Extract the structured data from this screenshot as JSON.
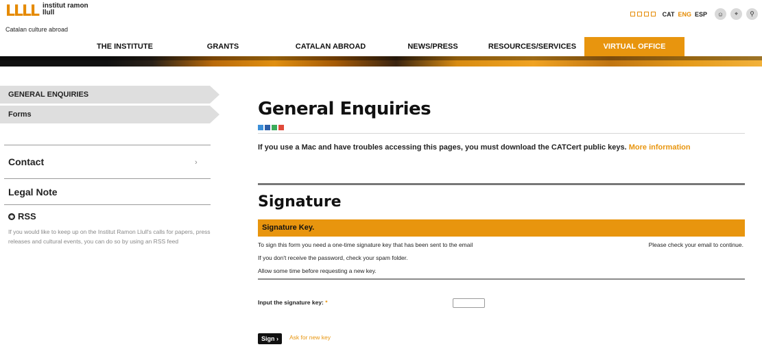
{
  "brand": {
    "logo_mark": "LLLL",
    "name": "institut ramon llull",
    "tagline": "Catalan culture abroad",
    "accent_color": "#e8950e"
  },
  "header": {
    "languages": [
      "CAT",
      "ENG",
      "ESP"
    ],
    "active_language": "ENG",
    "icons": [
      "accessibility-icon",
      "location-icon",
      "search-icon"
    ]
  },
  "nav": {
    "items": [
      {
        "label": "THE INSTITUTE"
      },
      {
        "label": "GRANTS"
      },
      {
        "label": "CATALAN ABROAD"
      },
      {
        "label": "NEWS/PRESS"
      },
      {
        "label": "RESOURCES/SERVICES"
      },
      {
        "label": "VIRTUAL OFFICE",
        "active": true
      }
    ]
  },
  "sidebar": {
    "tabs": [
      "GENERAL ENQUIRIES",
      "Forms"
    ],
    "contact": "Contact",
    "contact_chevron": "›",
    "legal": "Legal Note",
    "rss_title": "RSS",
    "rss_text": "If you would like to keep up on the Institut Ramon Llull's calls for papers, press releases and cultural events, you can do so by using an RSS feed"
  },
  "main": {
    "title": "General Enquiries",
    "share_colors": [
      "#3b8fd8",
      "#2d5ea8",
      "#3cab5a",
      "#e04b3a"
    ],
    "notice_text": "If you use a Mac and have troubles accessing this pages, you must download the CATCert public keys.",
    "notice_link": "More information",
    "section_title": "Signature",
    "key_bar": "Signature Key.",
    "info_lines": [
      "To sign this form you need a one-time signature key that has been sent to the email",
      "If you don't receive the password, check your spam folder.",
      "Allow some time before requesting a new key."
    ],
    "info_right": "Please check your email to continue.",
    "field_label": "Input the signature key:",
    "field_required": "*",
    "field_value": "",
    "sign_button": "Sign ›",
    "ask_link": "Ask for new key"
  }
}
